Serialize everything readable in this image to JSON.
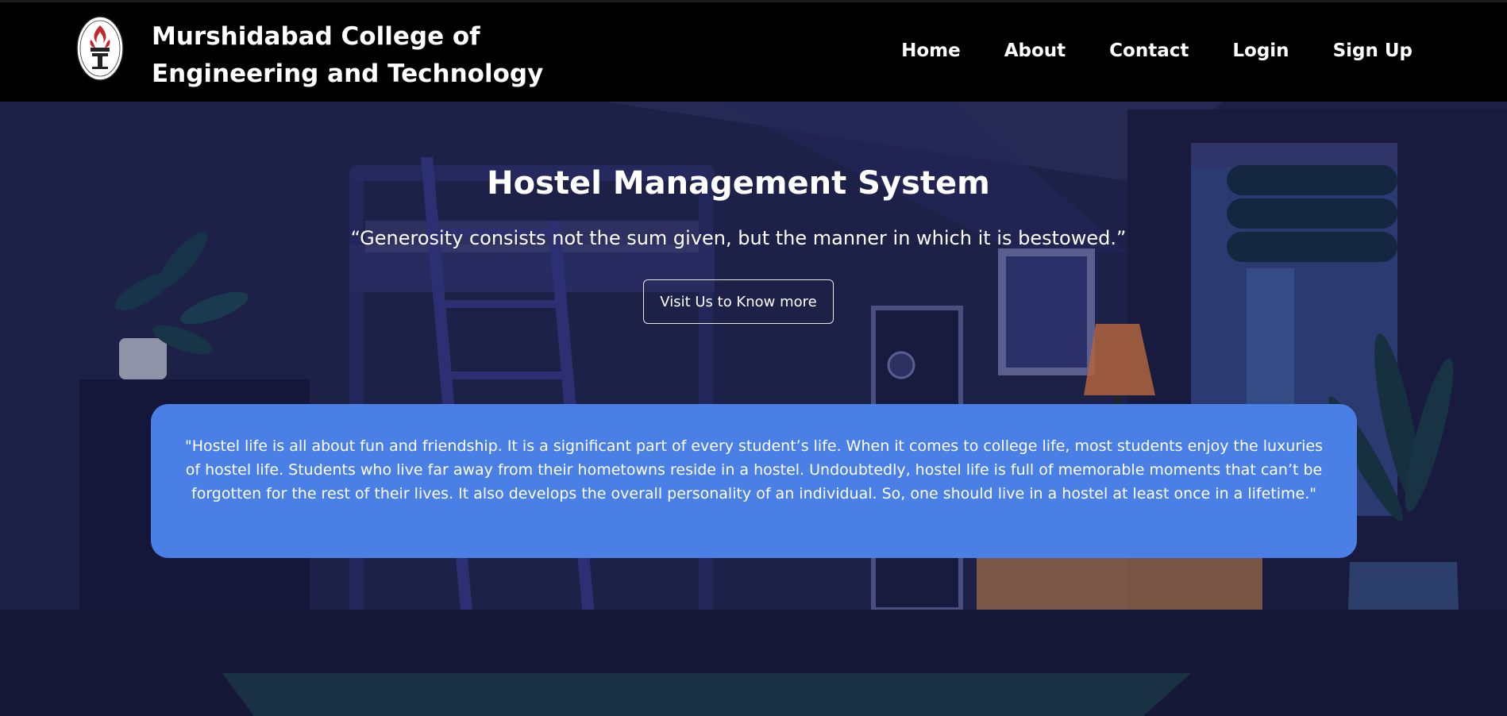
{
  "header": {
    "college_name": "Murshidabad College of Engineering and Technology",
    "logo_icon": "college-crest-icon"
  },
  "nav": {
    "items": [
      {
        "label": "Home"
      },
      {
        "label": "About"
      },
      {
        "label": "Contact"
      },
      {
        "label": "Login"
      },
      {
        "label": "Sign Up"
      }
    ]
  },
  "hero": {
    "title": "Hostel Management System",
    "quote": "“Generosity consists not the sum given, but the manner in which it is bestowed.”",
    "cta_label": "Visit Us to Know more"
  },
  "info": {
    "text": "\"Hostel life is all about fun and friendship. It is a significant part of every student’s life. When it comes to college life, most students enjoy the luxuries of hostel life. Students who live far away from their hometowns reside in a hostel. Undoubtedly, hostel life is full of memorable moments that can’t be forgotten for the rest of their lives. It also develops the overall personality of an individual. So, one should live in a hostel at least once in a lifetime.\""
  },
  "colors": {
    "header_bg": "#000000",
    "hero_bg": "#1a1d42",
    "card_bg": "#4a80e6",
    "text": "#ffffff"
  }
}
